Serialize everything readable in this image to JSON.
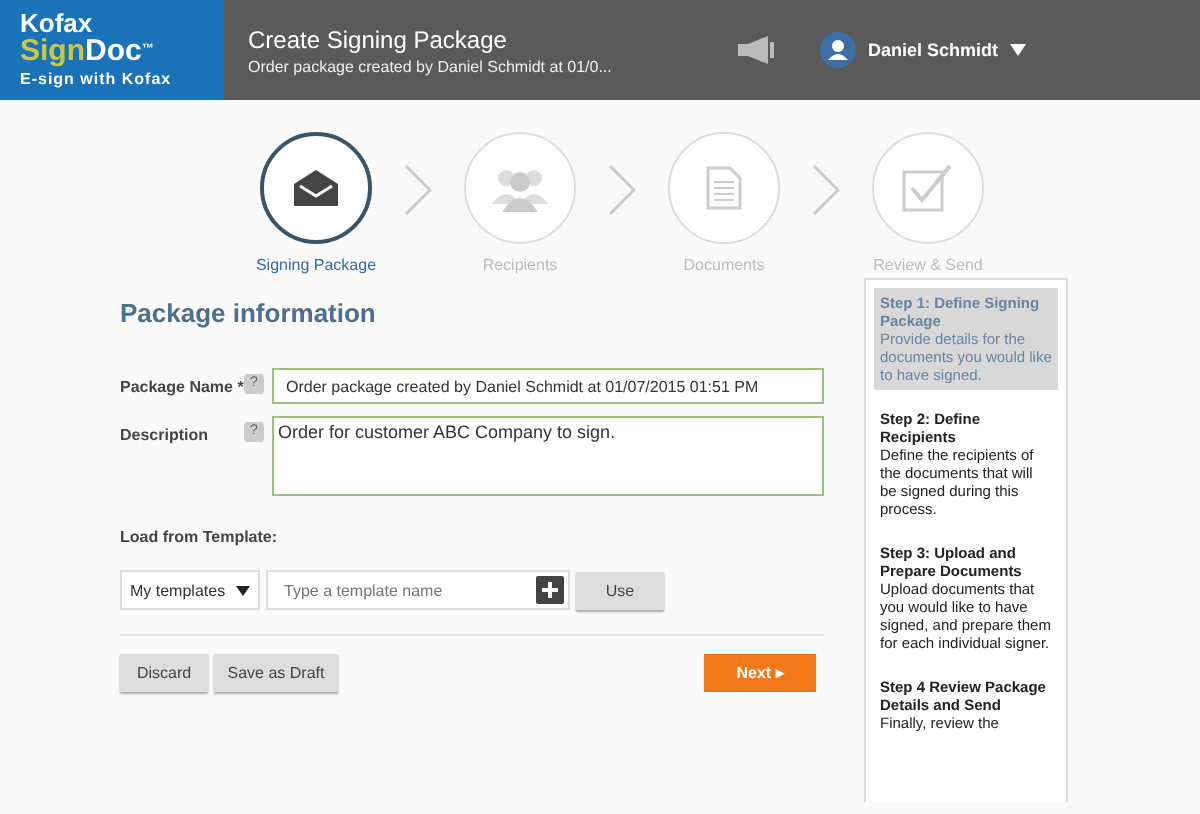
{
  "header": {
    "logo": {
      "line_1": "Kofax",
      "line_2a": "Sign",
      "line_2b": "Doc",
      "trademark": "™",
      "tagline": "E-sign with Kofax"
    },
    "title": "Create Signing Package",
    "subtitle": "Order package created by Daniel Schmidt at 01/0...",
    "user": "Daniel Schmidt"
  },
  "steps": [
    {
      "label": "Signing Package",
      "kind": "envelope",
      "selected": true
    },
    {
      "label": "Recipients",
      "kind": "people",
      "selected": false
    },
    {
      "label": "Documents",
      "kind": "document",
      "selected": false
    },
    {
      "label": "Review & Send",
      "kind": "checkbox",
      "selected": false
    }
  ],
  "form": {
    "heading": "Package information",
    "package_name": {
      "label": "Package Name",
      "required_mark": "*",
      "help": "?",
      "value": "Order package created by Daniel Schmidt at 01/07/2015 01:51 PM"
    },
    "description": {
      "label": "Description",
      "help": "?",
      "value": "Order for customer ABC Company to sign."
    },
    "template": {
      "label": "Load from Template:",
      "dropdown": "My templates",
      "placeholder": "Type a template name",
      "use_button": "Use"
    },
    "buttons": {
      "discard": "Discard",
      "save_draft": "Save as Draft",
      "next": "Next ▸"
    }
  },
  "help_panel": [
    {
      "title": "Step 1: Define Signing Package",
      "text": "Provide details for the documents you would like to have signed.",
      "selected": true
    },
    {
      "title": "Step 2: Define Recipients",
      "text": "Define the recipients of the documents that will be signed during this process.",
      "selected": false
    },
    {
      "title": "Step 3: Upload and Prepare Documents",
      "text": "Upload documents that you would like to have signed, and prepare them for each individual signer.",
      "selected": false
    },
    {
      "title": "Step 4 Review Package Details and Send",
      "text": "Finally, review the",
      "selected": false
    }
  ]
}
